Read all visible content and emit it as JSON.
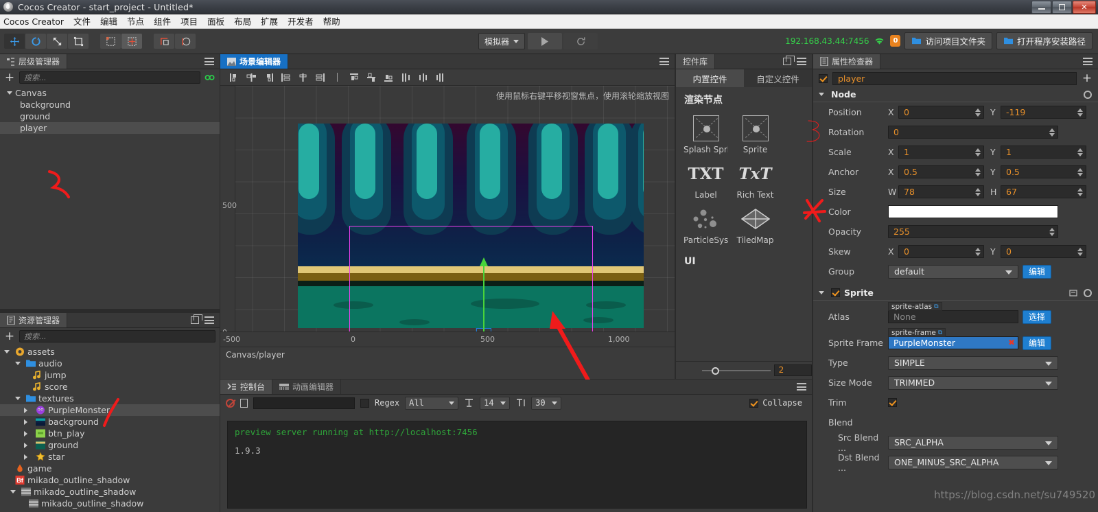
{
  "window": {
    "title": "Cocos Creator - start_project - Untitled*",
    "app_icon": "cocos-logo-icon",
    "buttons": {
      "minimize": "minimize-icon",
      "maximize": "maximize-icon",
      "close": "✕"
    }
  },
  "menubar": {
    "items": [
      "Cocos Creator",
      "文件",
      "编辑",
      "节点",
      "组件",
      "项目",
      "面板",
      "布局",
      "扩展",
      "开发者",
      "帮助"
    ]
  },
  "toolbar": {
    "tools": [
      {
        "name": "move-tool",
        "glyph": "✥",
        "selected": true
      },
      {
        "name": "rotate-tool",
        "glyph": "⟳",
        "selected": false
      },
      {
        "name": "scale-tool",
        "glyph": "⤢",
        "selected": false
      },
      {
        "name": "rect-tool",
        "glyph": "▣",
        "selected": false
      }
    ],
    "align_tools": [
      {
        "name": "pivot-tool",
        "glyph": "⊞",
        "selected": false
      },
      {
        "name": "grid-tool",
        "glyph": "▦",
        "selected": true
      }
    ],
    "coord_tools": [
      {
        "name": "local-coord-tool",
        "glyph": "⌐",
        "selected": false
      },
      {
        "name": "global-coord-tool",
        "glyph": "◉",
        "selected": false
      }
    ],
    "simulator_label": "模拟器",
    "play_label": "▶",
    "refresh_label": "⟳",
    "ip_address": "192.168.43.44:7456",
    "wifi_icon": "wifi-icon",
    "device_count": "0",
    "open_project_folder": "访问项目文件夹",
    "open_install_path": "打开程序安装路径"
  },
  "hierarchy": {
    "tab_label": "层级管理器",
    "tab_icon": "hierarchy-icon",
    "search_placeholder": "搜索...",
    "nodes": [
      {
        "label": "Canvas",
        "depth": 0,
        "expanded": true,
        "selected": false
      },
      {
        "label": "background",
        "depth": 1,
        "expanded": null,
        "selected": false
      },
      {
        "label": "ground",
        "depth": 1,
        "expanded": null,
        "selected": false
      },
      {
        "label": "player",
        "depth": 1,
        "expanded": null,
        "selected": true
      }
    ]
  },
  "assets": {
    "tab_label": "资源管理器",
    "tab_icon": "assets-icon",
    "search_placeholder": "搜索...",
    "items": [
      {
        "label": "assets",
        "depth": 0,
        "icon": "assets-root-icon",
        "expanded": true,
        "arrow": false,
        "selected": false
      },
      {
        "label": "audio",
        "depth": 1,
        "icon": "folder-icon",
        "expanded": true,
        "arrow": false,
        "selected": false
      },
      {
        "label": "jump",
        "depth": 2,
        "icon": "audio-icon",
        "expanded": null,
        "arrow": false,
        "selected": false
      },
      {
        "label": "score",
        "depth": 2,
        "icon": "audio-icon",
        "expanded": null,
        "arrow": false,
        "selected": false
      },
      {
        "label": "textures",
        "depth": 1,
        "icon": "folder-icon",
        "expanded": true,
        "arrow": false,
        "selected": false
      },
      {
        "label": "PurpleMonster",
        "depth": 2,
        "icon": "monster-icon",
        "expanded": false,
        "arrow": true,
        "selected": true
      },
      {
        "label": "background",
        "depth": 2,
        "icon": "image-icon",
        "expanded": false,
        "arrow": true,
        "selected": false
      },
      {
        "label": "btn_play",
        "depth": 2,
        "icon": "btn-icon",
        "expanded": false,
        "arrow": true,
        "selected": false
      },
      {
        "label": "ground",
        "depth": 2,
        "icon": "ground-icon",
        "expanded": false,
        "arrow": true,
        "selected": false
      },
      {
        "label": "star",
        "depth": 2,
        "icon": "star-icon",
        "expanded": false,
        "arrow": true,
        "selected": false
      },
      {
        "label": "game",
        "depth": 1,
        "icon": "script-icon",
        "expanded": null,
        "arrow": false,
        "selected": false
      },
      {
        "label": "mikado_outline_shadow",
        "depth": 1,
        "icon": "bitmapfont-icon",
        "expanded": null,
        "arrow": false,
        "selected": false
      },
      {
        "label": "mikado_outline_shadow",
        "depth": 1,
        "icon": "image-icon",
        "expanded": true,
        "arrow": false,
        "selected": false
      },
      {
        "label": "mikado_outline_shadow",
        "depth": 2,
        "icon": "image-icon",
        "expanded": null,
        "arrow": false,
        "selected": false
      }
    ]
  },
  "scene": {
    "tab_label": "场景编辑器",
    "tab_icon": "scene-icon",
    "align_buttons": [
      "align-left",
      "align-center-h",
      "align-right",
      "dist-left",
      "dist-center",
      "dist-right",
      "separator",
      "align-top",
      "align-middle",
      "align-bottom",
      "dist-top",
      "dist-middle",
      "dist-bottom"
    ],
    "hint": "使用鼠标右键平移视窗焦点，使用滚轮缩放视图",
    "ruler_v": [
      "500",
      "0"
    ],
    "ruler_h": [
      "-500",
      "0",
      "500",
      "1,000"
    ],
    "breadcrumb": "Canvas/player",
    "gizmo": {
      "x_axis_color": "#f21a1a",
      "y_axis_color": "#48d43a",
      "selection_color": "#f03ff0",
      "node_box_color": "#1f7fe0"
    }
  },
  "widgets": {
    "tab_label": "控件库",
    "tab_icon": "widgets-icon",
    "subtabs": [
      {
        "label": "内置控件",
        "active": true
      },
      {
        "label": "自定义控件",
        "active": false
      }
    ],
    "sections": [
      {
        "title": "渲染节点",
        "items": [
          {
            "label": "Splash Sprit",
            "icon": "sprite-icon"
          },
          {
            "label": "Sprite",
            "icon": "sprite-icon"
          },
          {
            "label": "Label",
            "icon": "TXT"
          },
          {
            "label": "Rich Text",
            "icon": "TxT"
          },
          {
            "label": "ParticleSyst",
            "icon": "particle-icon"
          },
          {
            "label": "TiledMap",
            "icon": "tiledmap-icon"
          }
        ]
      },
      {
        "title": "UI",
        "items": []
      }
    ],
    "zoom_value": "2"
  },
  "inspector": {
    "tab_label": "属性检查器",
    "tab_icon": "inspector-icon",
    "node_enabled": true,
    "node_name": "player",
    "add_component_label": "+",
    "node_section": {
      "title": "Node",
      "properties": [
        {
          "label": "Position",
          "type": "xy",
          "x_label": "X",
          "x": "0",
          "y_label": "Y",
          "y": "-119"
        },
        {
          "label": "Rotation",
          "type": "single",
          "value": "0"
        },
        {
          "label": "Scale",
          "type": "xy",
          "x_label": "X",
          "x": "1",
          "y_label": "Y",
          "y": "1"
        },
        {
          "label": "Anchor",
          "type": "xy",
          "x_label": "X",
          "x": "0.5",
          "y_label": "Y",
          "y": "0.5"
        },
        {
          "label": "Size",
          "type": "xy",
          "x_label": "W",
          "x": "78",
          "y_label": "H",
          "y": "67"
        },
        {
          "label": "Color",
          "type": "color",
          "value": "#ffffff"
        },
        {
          "label": "Opacity",
          "type": "single",
          "value": "255"
        },
        {
          "label": "Skew",
          "type": "xy",
          "x_label": "X",
          "x": "0",
          "y_label": "Y",
          "y": "0"
        },
        {
          "label": "Group",
          "type": "select-btn",
          "value": "default",
          "button": "编辑"
        }
      ]
    },
    "sprite_section": {
      "title": "Sprite",
      "enabled": true,
      "properties": [
        {
          "label": "Atlas",
          "type": "asset",
          "tag": "sprite-atlas",
          "value": "None",
          "filled": false,
          "button": "选择"
        },
        {
          "label": "Sprite Frame",
          "type": "asset",
          "tag": "sprite-frame",
          "value": "PurpleMonster",
          "filled": true,
          "button": "编辑"
        },
        {
          "label": "Type",
          "type": "select",
          "value": "SIMPLE"
        },
        {
          "label": "Size Mode",
          "type": "select",
          "value": "TRIMMED"
        },
        {
          "label": "Trim",
          "type": "checkbox",
          "checked": true
        },
        {
          "label": "Blend",
          "type": "header"
        },
        {
          "label": "Src Blend ...",
          "type": "select",
          "value": "SRC_ALPHA",
          "indent": true
        },
        {
          "label": "Dst Blend ...",
          "type": "select",
          "value": "ONE_MINUS_SRC_ALPHA",
          "indent": true
        }
      ]
    }
  },
  "console": {
    "tabs": [
      {
        "label": "控制台",
        "icon": "console-icon",
        "active": true
      },
      {
        "label": "动画编辑器",
        "icon": "animation-icon",
        "active": false
      }
    ],
    "clear_icon": "clear-icon",
    "export_icon": "export-icon",
    "filter_value": "",
    "regex_label": "Regex",
    "level_filter": "All",
    "font_size_icon": "font-size-icon",
    "font_size": "14",
    "line_height_icon": "line-height-icon",
    "line_height": "30",
    "collapse_label": "Collapse",
    "collapse_checked": true,
    "logs": [
      {
        "text": "preview server running at http://localhost:7456",
        "level": "green"
      },
      {
        "text": "1.9.3",
        "level": "gray"
      }
    ]
  },
  "watermark": "https://blog.csdn.net/su749520"
}
